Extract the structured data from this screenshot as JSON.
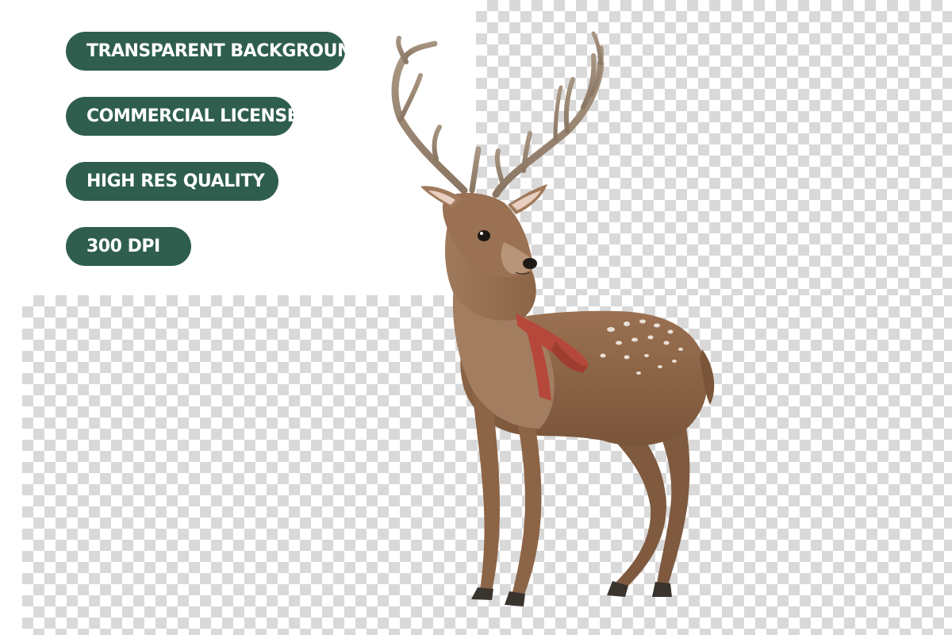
{
  "badges": [
    "TRANSPARENT BACKGROUND",
    "COMMERCIAL LICENSE",
    "HIGH RES QUALITY",
    "300 DPI"
  ],
  "colors": {
    "badge_bg": "#2f5e4e",
    "badge_text": "#ffffff",
    "checker_dark": "#d9d9d9",
    "checker_light": "#ffffff",
    "deer_body": "#8a6244",
    "scarf": "#b5483a"
  },
  "illustration": {
    "subject_icon": "deer-with-red-scarf"
  }
}
